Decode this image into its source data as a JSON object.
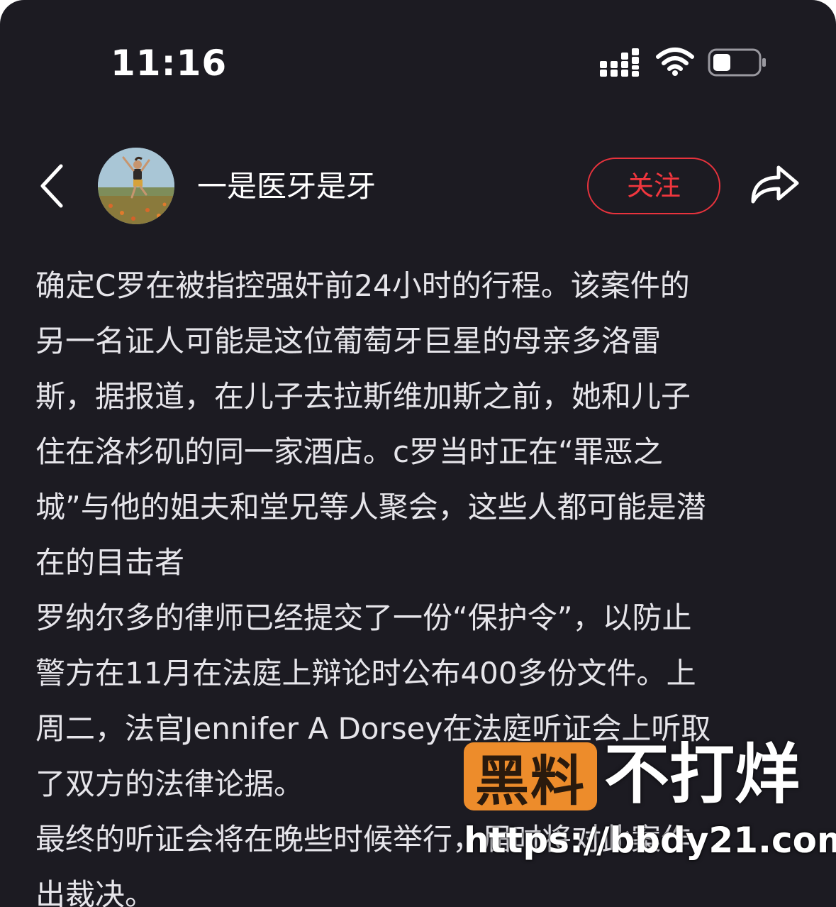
{
  "status_bar": {
    "time": "11:16"
  },
  "header": {
    "username": "一是医牙是牙",
    "follow_label": "关注"
  },
  "article": {
    "lines": [
      "确定C罗在被指控强奸前24小时的行程。该案件的",
      "另一名证人可能是这位葡萄牙巨星的母亲多洛雷",
      "斯，据报道，在儿子去拉斯维加斯之前，她和儿子",
      "住在洛杉矶的同一家酒店。c罗当时正在“罪恶之",
      "城”与他的姐夫和堂兄等人聚会，这些人都可能是潜",
      "在的目击者",
      "罗纳尔多的律师已经提交了一份“保护令”，以防止",
      "警方在11月在法庭上辩论时公布400多份文件。上",
      "周二，法官Jennifer A Dorsey在法庭听证会上听取",
      "了双方的法律论据。",
      "最终的听证会将在晚些时候举行，届时将对此案作",
      "出裁决。"
    ]
  },
  "watermark": {
    "badge": "黑料",
    "slogan": "不打烊",
    "url": "https://bbdy21.com"
  },
  "colors": {
    "background": "#1c1b22",
    "text": "#e6e5ea",
    "accent_red": "#e8333d",
    "watermark_orange": "#ed8c2b"
  },
  "icons": [
    "signal-icon",
    "wifi-icon",
    "battery-icon",
    "back-arrow-icon",
    "share-icon"
  ]
}
